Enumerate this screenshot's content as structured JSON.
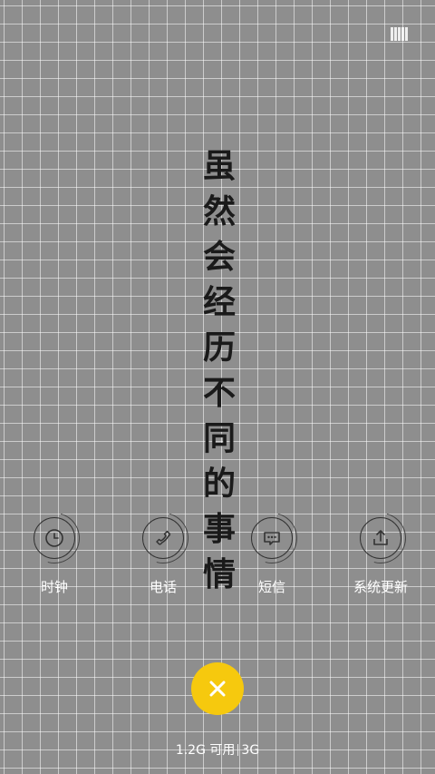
{
  "wallpaper": {
    "chars": [
      "虽",
      "然",
      "会",
      "经",
      "历",
      "不",
      "同",
      "的",
      "事",
      "情"
    ]
  },
  "status_icon": "barcode-icon",
  "apps": [
    {
      "label": "时钟",
      "icon": "clock-icon"
    },
    {
      "label": "电话",
      "icon": "phone-icon"
    },
    {
      "label": "短信",
      "icon": "message-icon"
    },
    {
      "label": "系统更新",
      "icon": "upload-icon"
    }
  ],
  "close_button": {
    "icon": "close-icon",
    "color": "#f6c90e"
  },
  "memory": {
    "available": "1.2G 可用",
    "total": "3G"
  }
}
